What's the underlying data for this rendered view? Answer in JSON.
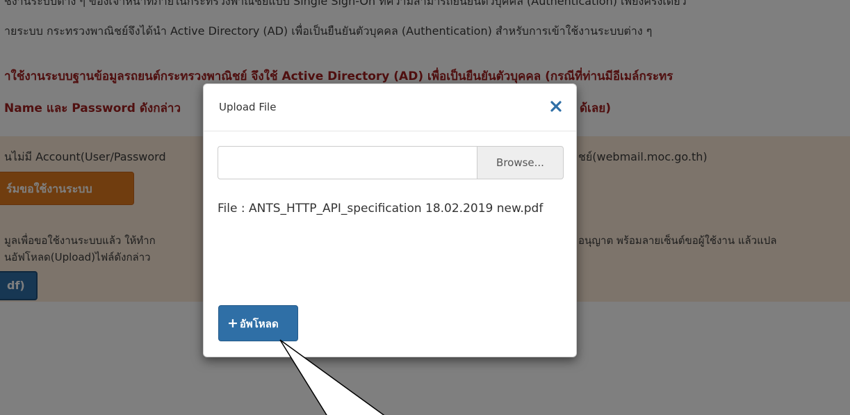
{
  "background": {
    "intro_line1": "ชงานระบบต่าง ๆ ของเจ้าหน้าที่ภายในกระทรวงพาณิชย์แบบ Single Sign-On ที่ความสามารถยืนยันตัวบุคคล (Authentication) เพียงครั้งเดียว",
    "intro_line2": "ายระบบ กระทรวงพาณิชย์จึงได้นำ Active Directory (AD) เพื่อเป็นยืนยันตัวบุคคล (Authentication) สำหรับการเข้าใช้งานระบบต่าง ๆ",
    "red_line1": "าใช้งานระบบฐานข้อมูลรถยนต์กระทรวงพาณิชย์ จึงใช้ Active Directory (AD) เพื่อเป็นยืนยันตัวบุคคล (กรณีที่ท่านมีอีเมล์กระทร",
    "red_line2_left": "Name และ Password ดังกล่าว",
    "red_line2_right": "ด้เลย)",
    "panel_line1_left": "นไม่มี Account(User/Password",
    "panel_line1_right": "ชย์(webmail.moc.go.th)",
    "request_button": "ร์มขอใช้งานระบบ",
    "panel_line2_left": "มูลเพื่อขอใช้งานระบบแล้ว ให้ทำก",
    "panel_line2_right": "อนุญาต พร้อมลายเซ็นต์ขอผู้ใช้งาน แล้วแปล",
    "panel_line3": "นอัฟโหลด(Upload)ไฟล์ดังกล่าว",
    "pdf_button": "df)"
  },
  "modal": {
    "title": "Upload File",
    "close_icon": "close-icon",
    "file_input_value": "",
    "browse_label": "Browse...",
    "file_label": "File : ANTS_HTTP_API_specification 18.02.2019 new.pdf",
    "upload_plus": "+",
    "upload_label": "อัพโหลด"
  },
  "colors": {
    "primary": "#2f6fa6",
    "orange": "#e07a1f",
    "warning_text": "#a02020",
    "panel_bg": "#fbe9d6"
  }
}
